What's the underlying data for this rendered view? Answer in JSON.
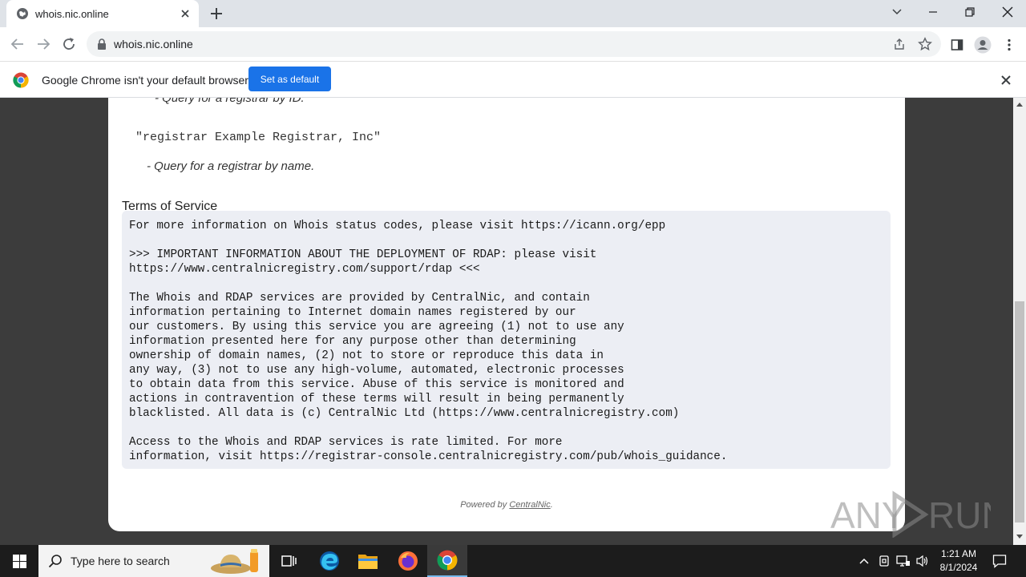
{
  "tab": {
    "title": "whois.nic.online"
  },
  "omnibox": {
    "url": "whois.nic.online"
  },
  "infobar": {
    "message": "Google Chrome isn't your default browser",
    "button_label": "Set as default"
  },
  "page": {
    "cut_off_text": "- Query for a registrar by ID.",
    "example_query": "\"registrar Example Registrar, Inc\"",
    "example_description": "- Query for a registrar by name.",
    "section_heading": "Terms of Service",
    "terms_lines": [
      "For more information on Whois status codes, please visit https://icann.org/epp",
      "",
      ">>> IMPORTANT INFORMATION ABOUT THE DEPLOYMENT OF RDAP: please visit",
      "https://www.centralnicregistry.com/support/rdap <<<",
      "",
      "The Whois and RDAP services are provided by CentralNic, and contain",
      "information pertaining to Internet domain names registered by our",
      "our customers. By using this service you are agreeing (1) not to use any",
      "information presented here for any purpose other than determining",
      "ownership of domain names, (2) not to store or reproduce this data in",
      "any way, (3) not to use any high-volume, automated, electronic processes",
      "to obtain data from this service. Abuse of this service is monitored and",
      "actions in contravention of these terms will result in being permanently",
      "blacklisted. All data is (c) CentralNic Ltd (https://www.centralnicregistry.com)",
      "",
      "Access to the Whois and RDAP services is rate limited. For more",
      "information, visit https://registrar-console.centralnicregistry.com/pub/whois_guidance."
    ],
    "powered_by_prefix": "Powered by ",
    "powered_by_link": "CentralNic",
    "powered_by_suffix": "."
  },
  "watermark": {
    "left": "ANY",
    "right": "RUN"
  },
  "taskbar": {
    "search_placeholder": "Type here to search",
    "time": "1:21 AM",
    "date": "8/1/2024"
  },
  "colors": {
    "accent_button": "#1a73e8",
    "tos_background": "#eceef4",
    "page_background": "#3c3c3c"
  }
}
